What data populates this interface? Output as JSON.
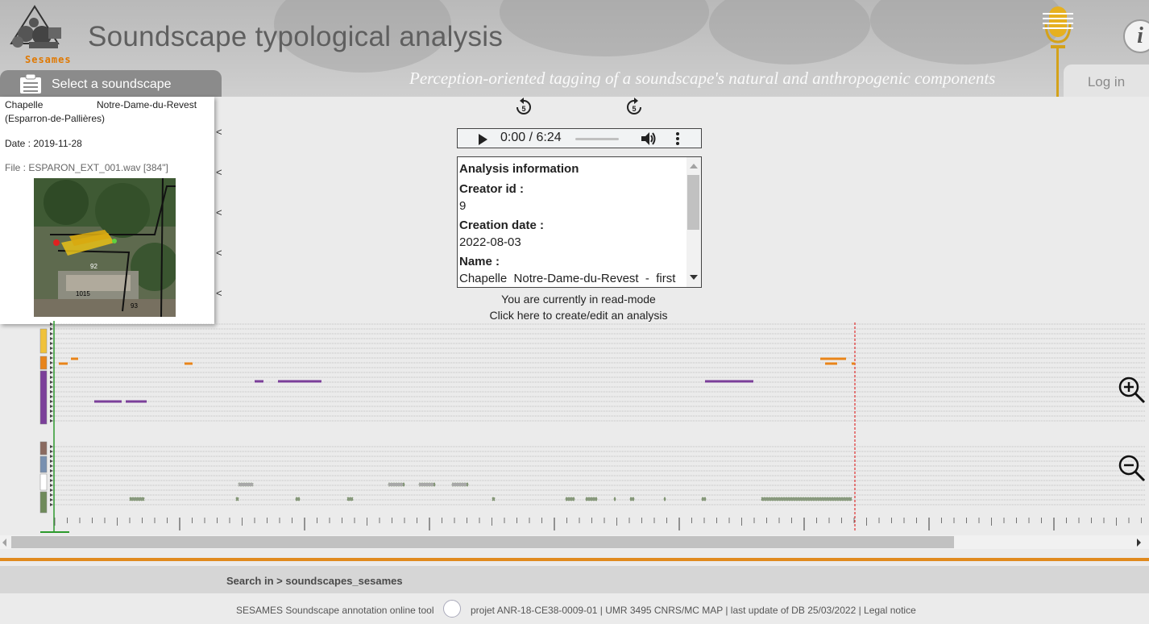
{
  "header": {
    "logo_text": "Sesames",
    "title": "Soundscape typological analysis",
    "subtitle": "Perception-oriented tagging of a soundscape's natural and anthropogenic components",
    "login_label": "Log in",
    "info_icon": "i"
  },
  "soundscape_panel": {
    "tab_label": "Select a soundscape",
    "name_part1": "Chapelle",
    "name_part2": "Notre-Dame-du-Revest",
    "location": "(Esparron-de-Pallières)",
    "date": "Date : 2019-11-28",
    "file": "File : ESPARON_EXT_001.wav [384\"]",
    "map_labels": [
      "92",
      "1015",
      "93"
    ]
  },
  "player": {
    "time": "0:00 / 6:24",
    "skip_back_label": "5",
    "skip_forward_label": "5",
    "progress": 0
  },
  "analysis_info": {
    "heading": "Analysis information",
    "creator_label": "Creator id :",
    "creator_value": "9",
    "creation_date_label": "Creation date :",
    "creation_date_value": "2022-08-03",
    "name_label": "Name :",
    "name_value": "Chapelle  Notre-Dame-du-Revest  -  first"
  },
  "mode": {
    "read_mode_text": "You are currently in read-mode",
    "edit_link_text": "Click here to create/edit an analysis"
  },
  "timeline": {
    "category_colors": [
      "#f0c23a",
      "#e8841a",
      "#7b3f9a",
      "#8a6a60",
      "#7890b0",
      "#ffffff",
      "#6f8a5a"
    ],
    "cursor_color": "#e03030",
    "zoom_in_icon": "zoom-in",
    "zoom_out_icon": "zoom-out"
  },
  "footer": {
    "search_path": "Search in > soundscapes_sesames",
    "tool_name": "SESAMES Soundscape annotation online tool",
    "credits": "projet ANR-18-CE38-0009-01 | UMR 3495 CNRS/MC MAP | last update of DB 25/03/2022 | Legal notice"
  }
}
